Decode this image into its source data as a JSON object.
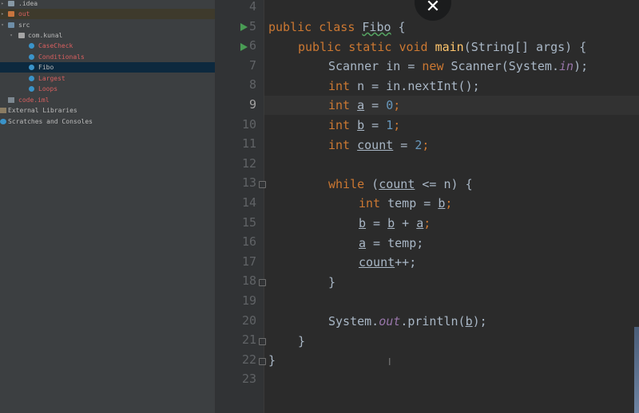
{
  "project_tree": {
    "items": [
      {
        "label": ".idea",
        "icon": "folder-icon",
        "arrow": "▸"
      },
      {
        "label": "out",
        "icon": "folder-out-icon",
        "arrow": "▸"
      },
      {
        "label": "src",
        "icon": "folder-src-icon",
        "arrow": "▾"
      },
      {
        "label": "com.kunal",
        "icon": "package-icon",
        "arrow": "▾"
      },
      {
        "label": "CaseCheck",
        "icon": "class-icon"
      },
      {
        "label": "Conditionals",
        "icon": "class-icon"
      },
      {
        "label": "Fibo",
        "icon": "class-icon",
        "selected": true
      },
      {
        "label": "Largest",
        "icon": "class-icon"
      },
      {
        "label": "Loops",
        "icon": "class-icon"
      },
      {
        "label": "code.iml",
        "icon": "iml-file-icon"
      },
      {
        "label": "External Libraries",
        "icon": "library-icon",
        "arrow": "▸"
      },
      {
        "label": "Scratches and Consoles",
        "icon": "scratch-icon",
        "arrow": "▸"
      }
    ]
  },
  "editor": {
    "line_numbers": [
      "4",
      "5",
      "6",
      "7",
      "8",
      "9",
      "10",
      "11",
      "12",
      "13",
      "14",
      "15",
      "16",
      "17",
      "18",
      "19",
      "20",
      "21",
      "22",
      "23"
    ],
    "current_line": "9",
    "code": {
      "l5": {
        "public": "public",
        "class": "class",
        "name": "Fibo",
        "brace": " {"
      },
      "l6": {
        "public": "public",
        "static": "static",
        "void": "void",
        "main": "main",
        "rest": "(String[] args) {"
      },
      "l7": {
        "a": "Scanner in = ",
        "new": "new",
        "b": " Scanner(System.",
        "in": "in",
        "c": ");"
      },
      "l8": {
        "int": "int",
        "rest": " n = in.nextInt();"
      },
      "l9": {
        "int": "int",
        "var": "a",
        "eq": " = ",
        "num": "0",
        "semi": ";"
      },
      "l10": {
        "int": "int",
        "var": "b",
        "eq": " = ",
        "num": "1",
        "semi": ";"
      },
      "l11": {
        "int": "int",
        "var": "count",
        "eq": " = ",
        "num": "2",
        "semi": ";"
      },
      "l13": {
        "while": "while",
        "open": " (",
        "count": "count",
        "rest": " <= n) {"
      },
      "l14": {
        "int": "int",
        "mid": " temp = ",
        "b": "b",
        "semi": ";"
      },
      "l15": {
        "b1": "b",
        "eq": " = ",
        "b2": "b",
        "plus": " + ",
        "a": "a",
        "semi": ";"
      },
      "l16": {
        "a": "a",
        "rest": " = temp;"
      },
      "l17": {
        "count": "count",
        "rest": "++;"
      },
      "l18": "}",
      "l20": {
        "a": "System.",
        "out": "out",
        "b": ".println(",
        "var": "b",
        "c": ");"
      },
      "l21": "}",
      "l22": "}"
    }
  },
  "overlay": {
    "close_symbol": "✕",
    "text_cursor": "I"
  }
}
